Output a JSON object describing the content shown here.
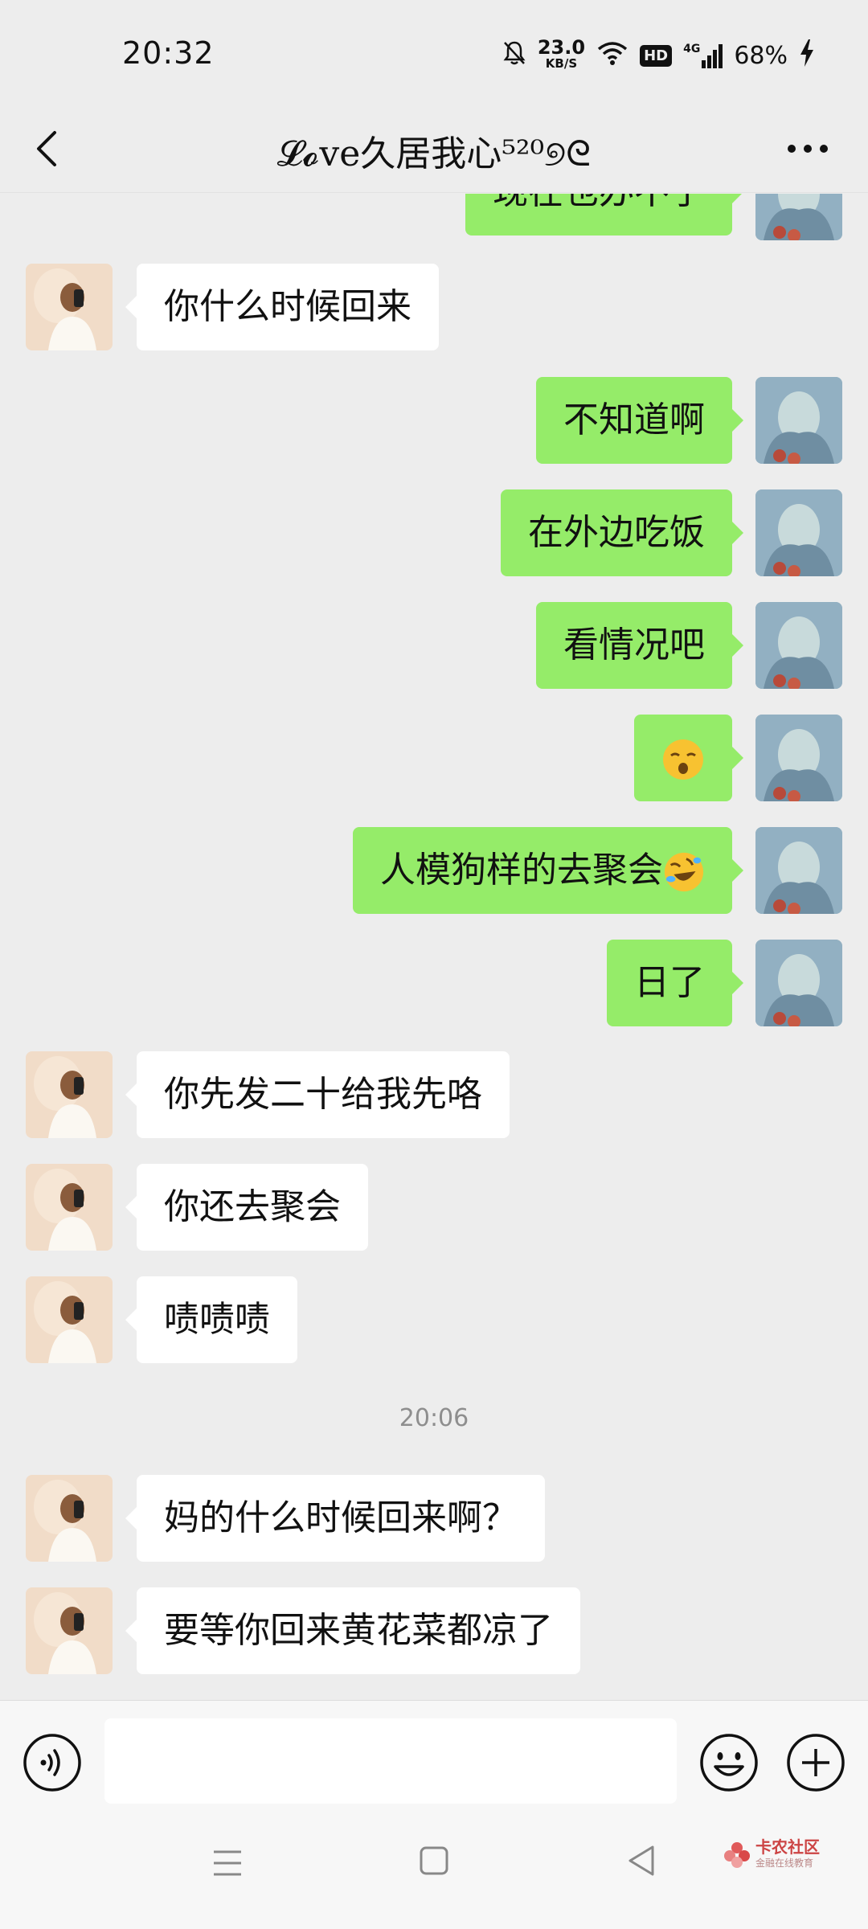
{
  "status_bar": {
    "time": "20:32",
    "speed_value": "23.0",
    "speed_unit": "KB/S",
    "hd": "HD",
    "network": "4G",
    "battery": "68%"
  },
  "header": {
    "title": "𝓛𝓸ve久居我心⁵²⁰୭ᘓ"
  },
  "chat": {
    "partial_text": "现在也办不了",
    "messages": [
      {
        "side": "other",
        "text": "你什么时候回来"
      },
      {
        "side": "self",
        "text": "不知道啊"
      },
      {
        "side": "self",
        "text": "在外边吃饭"
      },
      {
        "side": "self",
        "text": "看情况吧"
      },
      {
        "side": "self",
        "text": "",
        "emoji": "kissing-face-emoji"
      },
      {
        "side": "self",
        "text": "人模狗样的去聚会",
        "emoji": "rolling-laughing-emoji"
      },
      {
        "side": "self",
        "text": "日了"
      },
      {
        "side": "other",
        "text": "你先发二十给我先咯"
      },
      {
        "side": "other",
        "text": "你还去聚会"
      },
      {
        "side": "other",
        "text": "啧啧啧"
      },
      {
        "side": "other",
        "text": "妈的什么时候回来啊？"
      },
      {
        "side": "other",
        "text": "要等你回来黄花菜都凉了"
      }
    ],
    "timestamp": "20:06"
  },
  "input_bar": {
    "value": "",
    "icons": [
      "voice-icon",
      "emoji-icon",
      "plus-icon"
    ]
  },
  "watermark": {
    "title": "卡农社区",
    "subtitle": "金融在线教育"
  },
  "colors": {
    "background": "#ededed",
    "self_bubble": "#95ec69",
    "other_bubble": "#ffffff"
  }
}
